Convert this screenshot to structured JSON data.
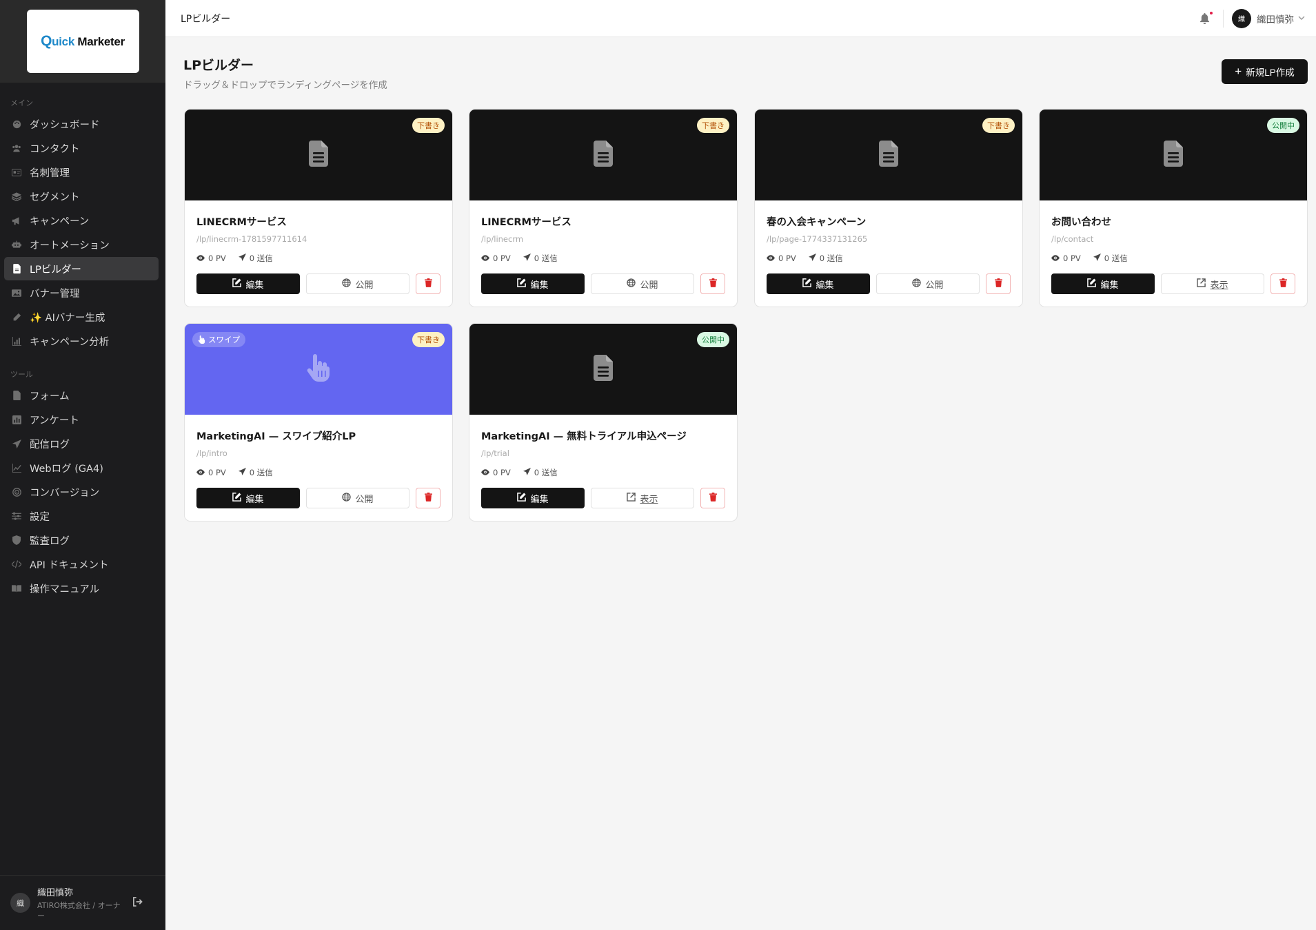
{
  "brand": {
    "logo_q": "Q",
    "logo_uick": "uick",
    "logo_rest": " Marketer",
    "accent": "#1e88c9"
  },
  "sidebar": {
    "section_main": "メイン",
    "section_tools": "ツール",
    "main_items": [
      {
        "label": "ダッシュボード",
        "icon": "palette-icon"
      },
      {
        "label": "コンタクト",
        "icon": "users-icon"
      },
      {
        "label": "名刺管理",
        "icon": "id-card-icon"
      },
      {
        "label": "セグメント",
        "icon": "layers-icon"
      },
      {
        "label": "キャンペーン",
        "icon": "megaphone-icon"
      },
      {
        "label": "オートメーション",
        "icon": "robot-icon"
      },
      {
        "label": "LPビルダー",
        "icon": "file-icon",
        "active": true
      },
      {
        "label": "バナー管理",
        "icon": "image-icon"
      },
      {
        "label": "✨ AIバナー生成",
        "icon": "pen-icon"
      },
      {
        "label": "キャンペーン分析",
        "icon": "bar-chart-icon"
      }
    ],
    "tool_items": [
      {
        "label": "フォーム",
        "icon": "form-icon"
      },
      {
        "label": "アンケート",
        "icon": "poll-icon"
      },
      {
        "label": "配信ログ",
        "icon": "send-icon"
      },
      {
        "label": "Webログ (GA4)",
        "icon": "line-chart-icon"
      },
      {
        "label": "コンバージョン",
        "icon": "target-icon"
      },
      {
        "label": "設定",
        "icon": "sliders-icon"
      },
      {
        "label": "監査ログ",
        "icon": "shield-icon"
      },
      {
        "label": "API ドキュメント",
        "icon": "code-icon"
      },
      {
        "label": "操作マニュアル",
        "icon": "book-icon"
      }
    ],
    "footer": {
      "avatar": "織",
      "name": "織田慎弥",
      "org": "ATIRO株式会社 / オーナー"
    }
  },
  "topbar": {
    "title": "LPビルダー",
    "avatar": "織",
    "user": "織田慎弥"
  },
  "page": {
    "title": "LPビルダー",
    "subtitle": "ドラッグ＆ドロップでランディングページを作成",
    "new_button": "新規LP作成"
  },
  "labels": {
    "edit": "編集",
    "publish": "公開",
    "view": "表示",
    "swipe": "スワイプ"
  },
  "colors": {
    "draft_bg": "#fdf1c4",
    "published_bg": "#d9f8e3",
    "swipe_thumb": "#6366f1",
    "delete_red": "#dc2626"
  },
  "cards": [
    {
      "title": "LINECRMサービス",
      "slug": "/lp/linecrm-1781597711614",
      "status": "下書き",
      "pv": "0 PV",
      "sends": "0 送信"
    },
    {
      "title": "LINECRMサービス",
      "slug": "/lp/linecrm",
      "status": "下書き",
      "pv": "0 PV",
      "sends": "0 送信"
    },
    {
      "title": "春の入会キャンペーン",
      "slug": "/lp/page-1774337131265",
      "status": "下書き",
      "pv": "0 PV",
      "sends": "0 送信"
    },
    {
      "title": "お問い合わせ",
      "slug": "/lp/contact",
      "status": "公開中",
      "pv": "0 PV",
      "sends": "0 送信"
    },
    {
      "title": "MarketingAI — スワイプ紹介LP",
      "slug": "/lp/intro",
      "status": "下書き",
      "pv": "0 PV",
      "sends": "0 送信"
    },
    {
      "title": "MarketingAI — 無料トライアル申込ページ",
      "slug": "/lp/trial",
      "status": "公開中",
      "pv": "0 PV",
      "sends": "0 送信"
    }
  ]
}
